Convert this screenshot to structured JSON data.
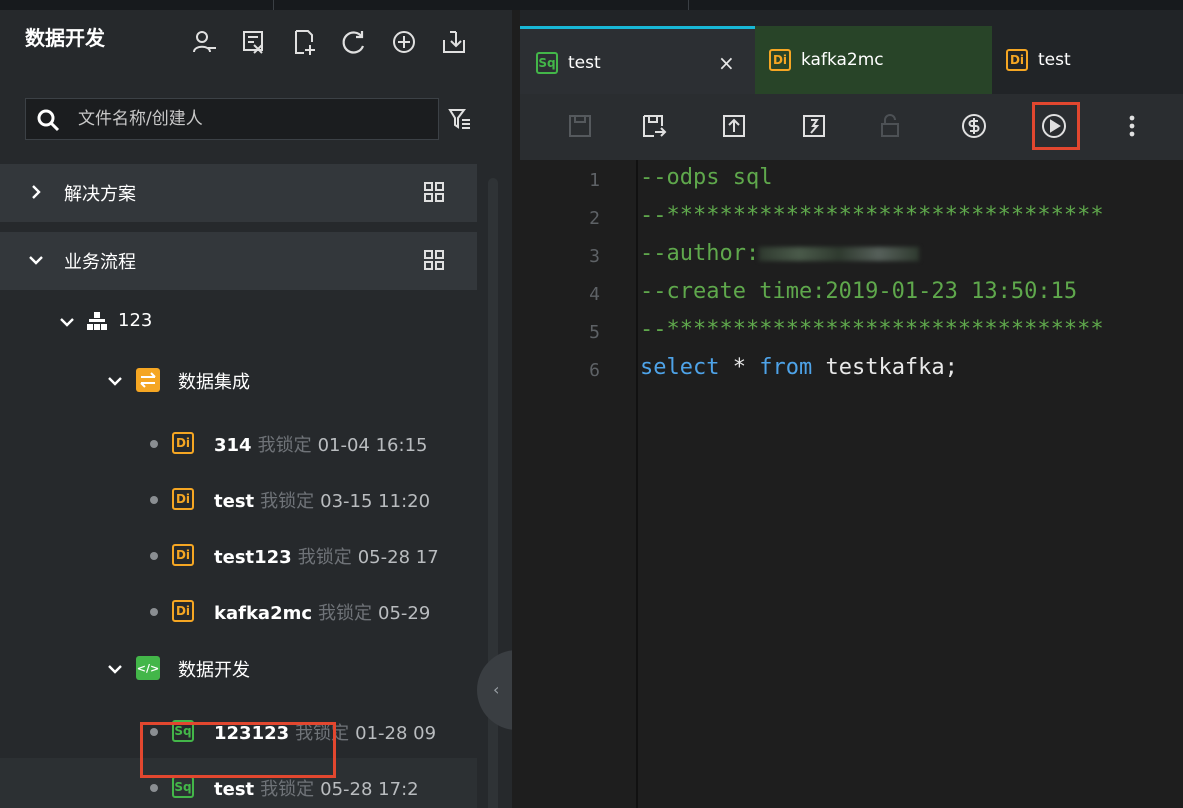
{
  "panel": {
    "title": "数据开发",
    "header_icons": [
      "person-icon",
      "graph-icon",
      "new-file-icon",
      "refresh-icon",
      "locate-icon",
      "import-icon"
    ],
    "search_placeholder": "文件名称/创建人"
  },
  "sections": [
    {
      "label": "解决方案",
      "expanded": false
    },
    {
      "label": "业务流程",
      "expanded": true
    }
  ],
  "tree": {
    "flow": {
      "label": "123"
    },
    "integration": {
      "label": "数据集成",
      "files": [
        {
          "badge": "Di",
          "name": "314",
          "lock": "我锁定",
          "time": "01-04 16:15"
        },
        {
          "badge": "Di",
          "name": "test",
          "lock": "我锁定",
          "time": "03-15 11:20"
        },
        {
          "badge": "Di",
          "name": "test123",
          "lock": "我锁定",
          "time": "05-28 17"
        },
        {
          "badge": "Di",
          "name": "kafka2mc",
          "lock": "我锁定",
          "time": "05-29"
        }
      ]
    },
    "dev": {
      "label": "数据开发",
      "files": [
        {
          "badge": "Sq",
          "name": "123123",
          "lock": "我锁定",
          "time": "01-28 09"
        },
        {
          "badge": "Sq",
          "name": "test",
          "lock": "我锁定",
          "time": "05-28 17:2"
        }
      ]
    }
  },
  "tabs": [
    {
      "badge": "Sq",
      "label": "test",
      "active": true
    },
    {
      "badge": "Di",
      "label": "kafka2mc",
      "active": false
    },
    {
      "badge": "Di",
      "label": "test",
      "active": false
    }
  ],
  "tab_close_symbol": "×",
  "toolbar": [
    "save-icon",
    "save-as-icon",
    "submit-icon",
    "publish-icon",
    "lock-icon",
    "cost-icon",
    "run-icon",
    "more-icon"
  ],
  "code": {
    "line_numbers": [
      "1",
      "2",
      "3",
      "4",
      "5",
      "6"
    ],
    "line1": "--odps sql",
    "line2": "--*********************************",
    "line3_prefix": "--author:",
    "line4": "--create time:2019-01-23 13:50:15",
    "line5": "--*********************************",
    "line6_kw1": "select",
    "line6_mid": " * ",
    "line6_kw2": "from",
    "line6_rest": " testkafka;"
  },
  "colors": {
    "accent_tab": "#18b7d6",
    "highlight": "#e2472f",
    "di_badge": "#f5a623",
    "sq_badge": "#43b649",
    "comment": "#5fa84c",
    "keyword": "#4ea3e8"
  }
}
